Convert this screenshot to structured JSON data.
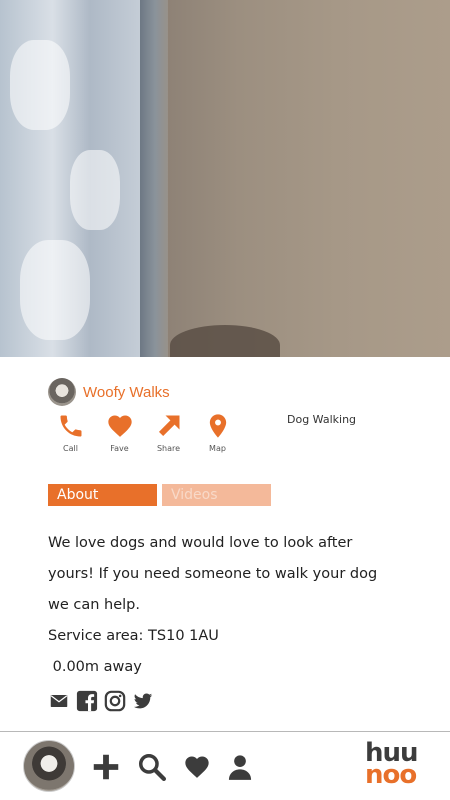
{
  "profile": {
    "name": "Woofy Walks",
    "category": "Dog Walking"
  },
  "actions": [
    {
      "label": "Call",
      "icon": "phone-icon"
    },
    {
      "label": "Fave",
      "icon": "heart-icon"
    },
    {
      "label": "Share",
      "icon": "share-arrow-icon"
    },
    {
      "label": "Map",
      "icon": "map-pin-icon"
    }
  ],
  "tabs": {
    "about": "About",
    "videos": "Videos"
  },
  "description": {
    "line1": "We love dogs and would love to look after",
    "line2": "yours! If you need someone to walk your dog",
    "line3": "we can help.",
    "service_area": "Service area: TS10 1AU",
    "distance": " 0.00m away"
  },
  "social": [
    "email-icon",
    "facebook-icon",
    "instagram-icon",
    "twitter-icon"
  ],
  "bottom_nav": [
    "user-avatar",
    "add-icon",
    "search-icon",
    "heart-icon",
    "person-icon"
  ],
  "logo": {
    "top": "huu",
    "bottom": "noo"
  },
  "colors": {
    "accent": "#e8702a",
    "accent_light": "#f4b99a",
    "icon_dark": "#3c3c3c"
  }
}
